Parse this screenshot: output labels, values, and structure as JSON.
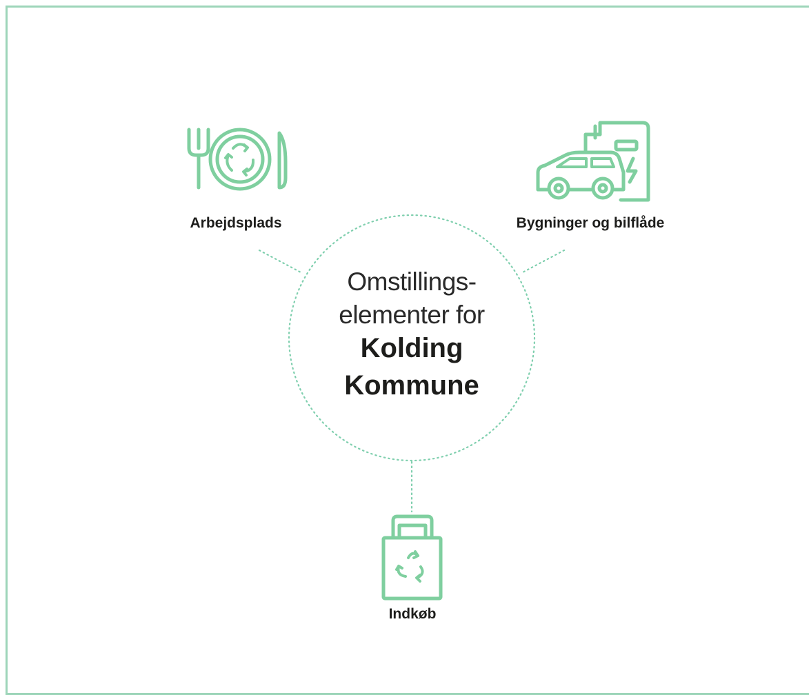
{
  "center": {
    "line1": "Omstillings-",
    "line2": "elementer for",
    "line3": "Kolding",
    "line4": "Kommune"
  },
  "nodes": [
    {
      "label": "Arbejdsplads",
      "icon": "plate-cutlery-recycle-icon"
    },
    {
      "label": "Bygninger og bilflåde",
      "icon": "ev-charging-car-icon"
    },
    {
      "label": "Indkøb",
      "icon": "recycle-bag-icon"
    }
  ],
  "colors": {
    "accent": "#7fcf9f",
    "frame": "#9dd5b9",
    "text": "#1d1d1b"
  }
}
